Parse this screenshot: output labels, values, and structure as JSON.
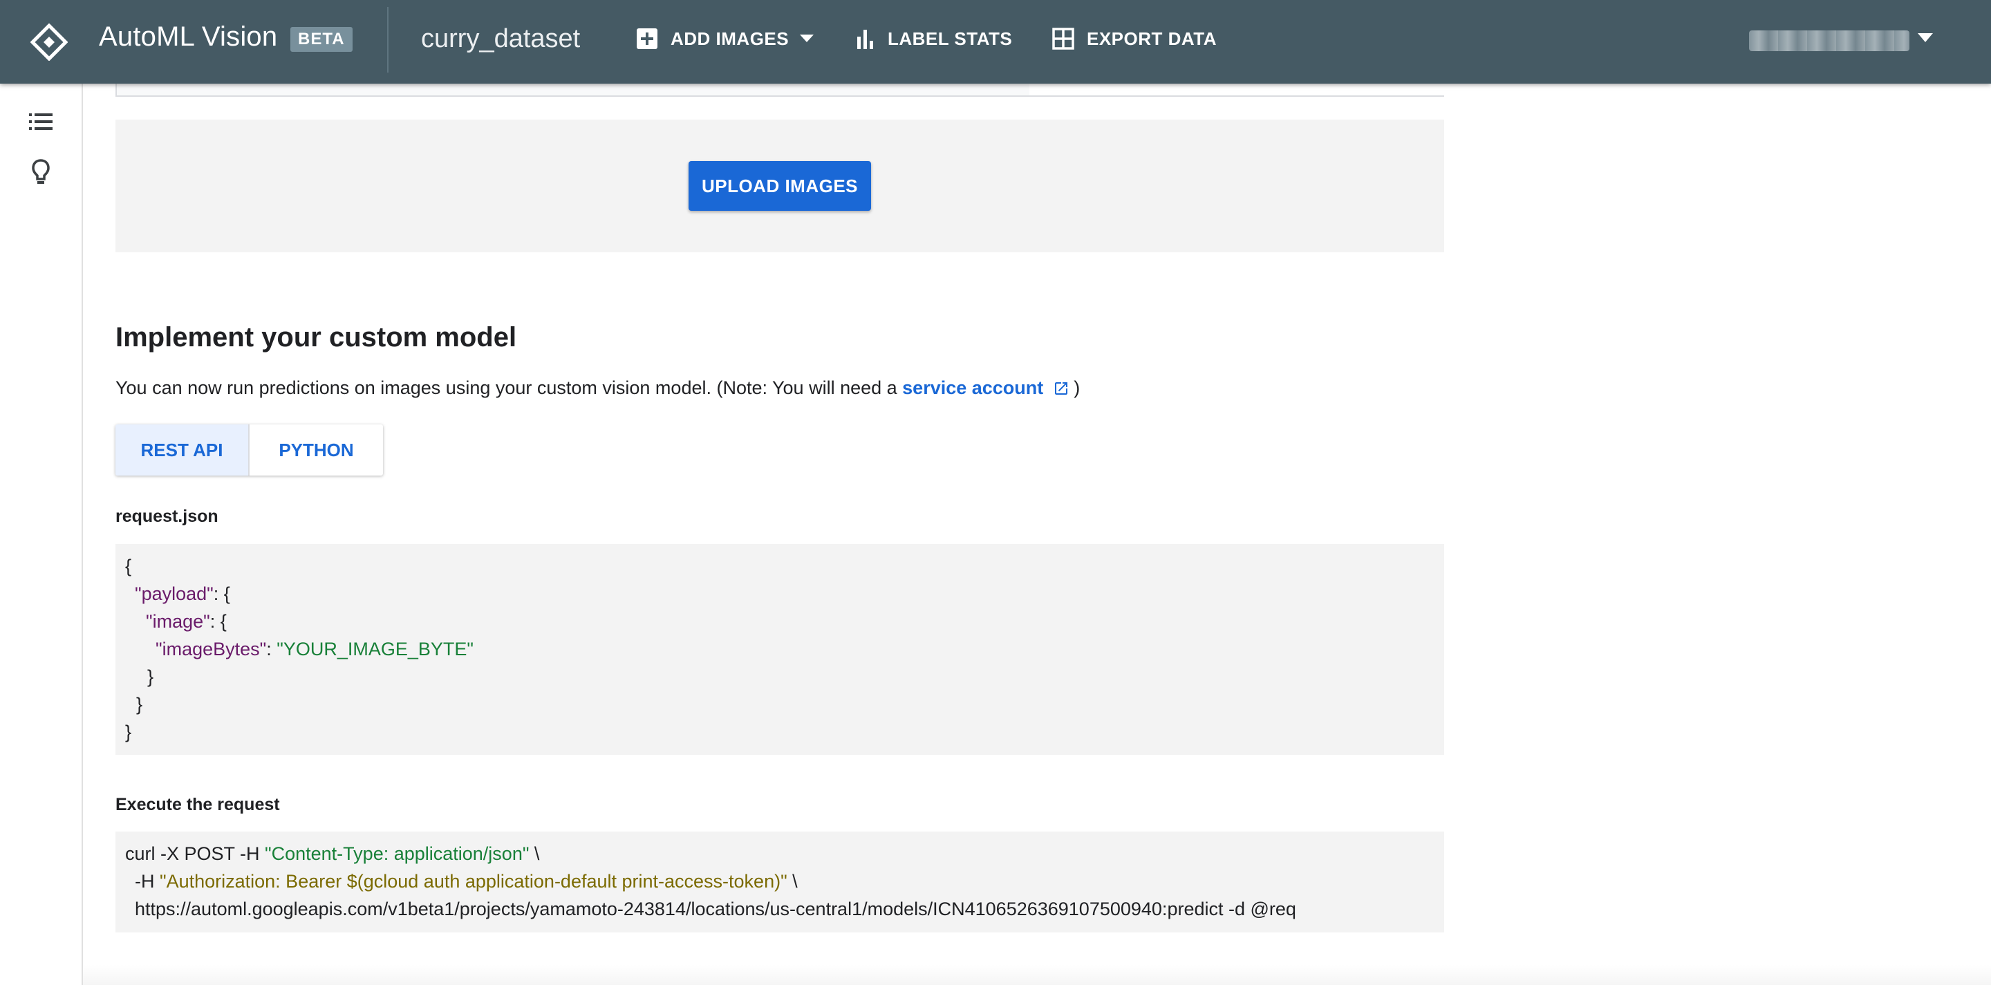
{
  "header": {
    "app_title": "AutoML Vision",
    "beta_badge": "BETA",
    "dataset_name": "curry_dataset",
    "nav": {
      "add_images": "ADD IMAGES",
      "label_stats": "LABEL STATS",
      "export_data": "EXPORT DATA"
    }
  },
  "upload": {
    "button_label": "UPLOAD IMAGES"
  },
  "implement": {
    "title": "Implement your custom model",
    "desc_prefix": "You can now run predictions on images using your custom vision model. (Note: You will need a ",
    "link_text": "service account",
    "desc_suffix": ")",
    "tabs": [
      "REST API",
      "PYTHON"
    ],
    "selected_tab": "REST API"
  },
  "request_json": {
    "label": "request.json",
    "lines": {
      "l1": "{",
      "l2_key": "\"payload\"",
      "l2_rest": ": {",
      "l3_key": "\"image\"",
      "l3_rest": ": {",
      "l4_key": "\"imageBytes\"",
      "l4_sep": ": ",
      "l4_val": "\"YOUR_IMAGE_BYTE\"",
      "l5": "}",
      "l6": "}",
      "l7": "}"
    }
  },
  "execute": {
    "label": "Execute the request",
    "line1_cmd": "curl -X POST -H ",
    "line1_str": "\"Content-Type: application/json\"",
    "line1_end": " \\",
    "line2_cmd": "-H ",
    "line2_str": "\"Authorization: Bearer $(gcloud auth application-default print-access-token)\"",
    "line2_end": " \\",
    "line3": "https://automl.googleapis.com/v1beta1/projects/yamamoto-243814/locations/us-central1/models/ICN4106526369107500940:predict -d @req"
  },
  "icons": {
    "logo": "automl-diamond-logo",
    "add": "add-box-icon",
    "stats": "bar-chart-icon",
    "export": "grid-table-icon",
    "rail_list": "list-icon",
    "rail_tips": "lightbulb-icon",
    "external": "open-in-new-icon"
  },
  "colors": {
    "header_bg": "#455a64",
    "primary": "#1a68d6",
    "code_bg": "#f3f3f3",
    "json_key": "#6a1b6a",
    "json_string": "#188038"
  }
}
